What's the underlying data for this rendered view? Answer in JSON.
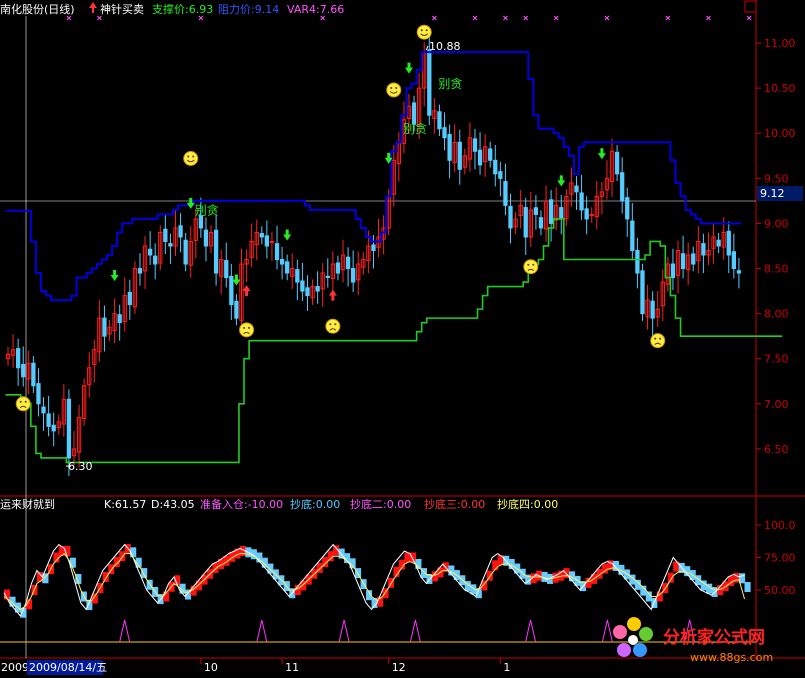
{
  "header": {
    "stock_name": "南化股份(日线)",
    "indicator_name": "神针买卖",
    "support_label": "支撑价:6.93",
    "resist_label": "阻力价:9.14",
    "var4_label": "VAR4:7.66"
  },
  "sub_header": {
    "indicator_name": "运来财就到",
    "k_label": "K:61.57",
    "d_label": "D:43.05",
    "prepare_label": "准备入仓:-10.00",
    "bottom1_label": "抄底:0.00",
    "bottom2_label": "抄底二:0.00",
    "bottom3_label": "抄底三:0.00",
    "bottom4_label": "抄底四:0.00"
  },
  "annotations": {
    "high_label": "10.88",
    "low_label": "6.30",
    "crosshair_price": "9.12",
    "date_label": "2009/08/14/五",
    "year_label": "2009",
    "sell_text": "别贪"
  },
  "watermark": {
    "text": "分析家公式网",
    "url": "www.88gs.com"
  },
  "colors": {
    "background": "#000000",
    "up": "#ff2020",
    "down": "#55ccff",
    "resistance": "#0000dd",
    "support": "#22cc22",
    "axis": "#cc0000",
    "text_yellow": "#ffff00",
    "text_green": "#22ee22",
    "text_magenta": "#ff55ff",
    "text_blue": "#3355ff"
  },
  "chart_data": [
    {
      "type": "candlestick",
      "ylim": [
        6.0,
        11.3
      ],
      "y_ticks": [
        "11.00",
        "10.50",
        "10.00",
        "9.50",
        "9.00",
        "8.50",
        "8.00",
        "7.50",
        "7.00",
        "6.50"
      ],
      "x_ticks": [
        "10",
        "11",
        "12",
        "1"
      ],
      "close": [
        7.55,
        7.6,
        7.4,
        7.3,
        7.45,
        7.2,
        7.0,
        6.9,
        6.75,
        6.7,
        6.8,
        7.05,
        6.4,
        6.5,
        6.85,
        7.2,
        7.4,
        7.6,
        7.95,
        7.75,
        7.85,
        8.0,
        7.9,
        8.2,
        8.1,
        8.5,
        8.45,
        8.75,
        8.65,
        8.55,
        8.9,
        8.8,
        8.75,
        8.95,
        8.85,
        8.55,
        8.8,
        9.05,
        8.95,
        8.75,
        8.9,
        8.45,
        8.6,
        8.4,
        8.1,
        7.95,
        8.55,
        8.6,
        8.8,
        8.9,
        8.85,
        8.75,
        8.8,
        8.6,
        8.55,
        8.45,
        8.5,
        8.35,
        8.25,
        8.2,
        8.3,
        8.25,
        8.45,
        8.4,
        8.55,
        8.45,
        8.65,
        8.5,
        8.35,
        8.55,
        8.6,
        8.75,
        8.7,
        8.85,
        8.95,
        9.3,
        9.7,
        9.9,
        10.15,
        10.3,
        10.1,
        10.5,
        10.9,
        10.2,
        10.25,
        10.05,
        9.95,
        9.7,
        9.9,
        9.6,
        9.75,
        9.95,
        9.8,
        9.65,
        9.85,
        9.7,
        9.55,
        9.5,
        9.2,
        8.95,
        9.05,
        9.2,
        8.85,
        9.15,
        9.1,
        8.95,
        9.25,
        9.0,
        9.2,
        9.05,
        9.3,
        9.45,
        9.35,
        9.15,
        9.05,
        9.1,
        9.3,
        9.35,
        9.5,
        9.8,
        9.55,
        9.25,
        9.05,
        8.7,
        8.45,
        8.0,
        8.15,
        7.95,
        8.05,
        8.35,
        8.55,
        8.4,
        8.7,
        8.5,
        8.65,
        8.55,
        8.8,
        8.65,
        8.7,
        8.85,
        8.75,
        8.9,
        8.65,
        8.5,
        8.45
      ],
      "resistance": [
        9.14,
        9.14,
        9.14,
        9.14,
        9.14,
        8.8,
        8.45,
        8.25,
        8.2,
        8.15,
        8.15,
        8.15,
        8.15,
        8.2,
        8.4,
        8.4,
        8.45,
        8.5,
        8.55,
        8.6,
        8.65,
        8.75,
        8.9,
        9.0,
        9.0,
        9.05,
        9.05,
        9.05,
        9.05,
        9.05,
        9.1,
        9.1,
        9.1,
        9.15,
        9.2,
        9.2,
        9.2,
        9.25,
        9.25,
        9.25,
        9.25,
        9.25,
        9.25,
        9.25,
        9.25,
        9.25,
        9.25,
        9.25,
        9.25,
        9.25,
        9.25,
        9.25,
        9.25,
        9.25,
        9.25,
        9.25,
        9.25,
        9.25,
        9.25,
        9.2,
        9.15,
        9.15,
        9.15,
        9.15,
        9.15,
        9.15,
        9.15,
        9.15,
        9.15,
        9.05,
        8.95,
        8.85,
        8.8,
        8.8,
        8.9,
        9.3,
        9.8,
        9.9,
        10.2,
        10.5,
        10.55,
        10.7,
        10.9,
        10.9,
        10.9,
        10.9,
        10.9,
        10.9,
        10.9,
        10.9,
        10.9,
        10.9,
        10.9,
        10.9,
        10.9,
        10.9,
        10.9,
        10.9,
        10.9,
        10.9,
        10.9,
        10.9,
        10.9,
        10.6,
        10.2,
        10.05,
        10.05,
        10.05,
        10.0,
        9.95,
        9.85,
        9.75,
        9.55,
        9.85,
        9.9,
        9.9,
        9.9,
        9.9,
        9.9,
        9.9,
        9.9,
        9.9,
        9.9,
        9.9,
        9.9,
        9.9,
        9.9,
        9.9,
        9.9,
        9.9,
        9.9,
        9.7,
        9.45,
        9.3,
        9.15,
        9.1,
        9.05,
        9.0,
        9.0,
        9.0,
        9.0,
        9.0,
        9.0,
        9.0,
        9.0
      ],
      "support": [
        7.1,
        7.1,
        7.1,
        7.05,
        7.0,
        6.75,
        6.45,
        6.4,
        6.4,
        6.4,
        6.4,
        6.4,
        6.35,
        6.35,
        6.35,
        6.35,
        6.35,
        6.35,
        6.35,
        6.35,
        6.35,
        6.35,
        6.35,
        6.35,
        6.35,
        6.35,
        6.35,
        6.35,
        6.35,
        6.35,
        6.35,
        6.35,
        6.35,
        6.35,
        6.35,
        6.35,
        6.35,
        6.35,
        6.35,
        6.35,
        6.35,
        6.35,
        6.35,
        6.35,
        6.35,
        6.35,
        7.0,
        7.5,
        7.7,
        7.7,
        7.7,
        7.7,
        7.7,
        7.7,
        7.7,
        7.7,
        7.7,
        7.7,
        7.7,
        7.7,
        7.7,
        7.7,
        7.7,
        7.7,
        7.7,
        7.7,
        7.7,
        7.7,
        7.7,
        7.7,
        7.7,
        7.7,
        7.7,
        7.7,
        7.7,
        7.7,
        7.7,
        7.7,
        7.7,
        7.7,
        7.7,
        7.8,
        7.9,
        7.95,
        7.95,
        7.95,
        7.95,
        7.95,
        7.95,
        7.95,
        7.95,
        7.95,
        7.95,
        8.05,
        8.2,
        8.3,
        8.3,
        8.3,
        8.3,
        8.3,
        8.3,
        8.3,
        8.35,
        8.5,
        8.55,
        8.6,
        8.75,
        8.95,
        9.05,
        9.05,
        8.6,
        8.6,
        8.6,
        8.6,
        8.6,
        8.6,
        8.6,
        8.6,
        8.6,
        8.6,
        8.6,
        8.6,
        8.6,
        8.6,
        8.6,
        8.6,
        8.65,
        8.8,
        8.8,
        8.75,
        8.4,
        8.2,
        7.95,
        7.75,
        7.75,
        7.75,
        7.75,
        7.75,
        7.75,
        7.75,
        7.75,
        7.75,
        7.75,
        7.75,
        7.75,
        7.75,
        7.75,
        7.75,
        7.75,
        7.75,
        7.75,
        7.75,
        7.75
      ]
    },
    {
      "type": "line",
      "ylim": [
        0,
        110
      ],
      "y_ticks": [
        "100.0",
        "75.00",
        "50.00"
      ],
      "series": [
        {
          "name": "K",
          "values": [
            48,
            40,
            35,
            30,
            40,
            55,
            65,
            60,
            70,
            80,
            85,
            82,
            70,
            55,
            40,
            35,
            45,
            55,
            65,
            70,
            75,
            80,
            85,
            80,
            70,
            60,
            50,
            45,
            40,
            45,
            55,
            60,
            50,
            45,
            50,
            55,
            60,
            65,
            70,
            72,
            75,
            78,
            80,
            82,
            80,
            78,
            75,
            70,
            65,
            60,
            55,
            50,
            45,
            50,
            55,
            60,
            65,
            70,
            75,
            80,
            85,
            80,
            75,
            70,
            60,
            50,
            40,
            35,
            40,
            50,
            60,
            70,
            75,
            80,
            78,
            70,
            60,
            55,
            60,
            65,
            70,
            65,
            60,
            55,
            50,
            48,
            45,
            55,
            65,
            75,
            78,
            75,
            70,
            65,
            60,
            55,
            58,
            62,
            60,
            58,
            60,
            62,
            65,
            60,
            55,
            50,
            55,
            60,
            65,
            70,
            72,
            70,
            65,
            60,
            55,
            50,
            45,
            40,
            35,
            45,
            55,
            65,
            75,
            70,
            65,
            60,
            55,
            50,
            48,
            46,
            50,
            55,
            60,
            62,
            60,
            61.57
          ]
        },
        {
          "name": "D",
          "values": [
            45,
            42,
            38,
            35,
            38,
            45,
            55,
            58,
            62,
            70,
            75,
            78,
            72,
            62,
            50,
            42,
            42,
            48,
            55,
            62,
            68,
            72,
            78,
            78,
            72,
            66,
            58,
            52,
            46,
            45,
            50,
            55,
            52,
            48,
            49,
            52,
            56,
            60,
            64,
            68,
            70,
            73,
            76,
            78,
            78,
            77,
            75,
            72,
            68,
            64,
            60,
            56,
            50,
            50,
            52,
            56,
            60,
            64,
            68,
            72,
            76,
            76,
            74,
            71,
            66,
            59,
            52,
            45,
            42,
            45,
            51,
            58,
            64,
            70,
            72,
            70,
            66,
            62,
            61,
            62,
            65,
            65,
            63,
            60,
            56,
            53,
            50,
            52,
            57,
            63,
            68,
            70,
            70,
            68,
            65,
            61,
            60,
            60,
            60,
            59,
            59,
            60,
            61,
            61,
            59,
            56,
            56,
            57,
            60,
            63,
            66,
            67,
            66,
            64,
            61,
            58,
            54,
            50,
            45,
            45,
            48,
            54,
            61,
            64,
            64,
            63,
            60,
            57,
            54,
            51,
            50,
            51,
            54,
            57,
            58,
            43.05
          ]
        }
      ]
    }
  ]
}
